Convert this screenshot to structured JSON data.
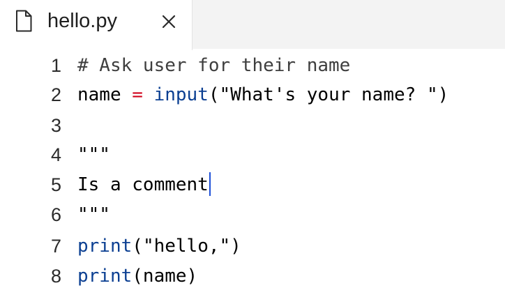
{
  "tab": {
    "title": "hello.py",
    "icon": "file-icon",
    "close_icon": "close-icon"
  },
  "editor": {
    "lines": [
      {
        "number": "1",
        "tokens": [
          {
            "type": "comment",
            "text": "# Ask user for their name"
          }
        ]
      },
      {
        "number": "2",
        "tokens": [
          {
            "type": "plain",
            "text": "name "
          },
          {
            "type": "op",
            "text": "="
          },
          {
            "type": "plain",
            "text": " "
          },
          {
            "type": "builtin",
            "text": "input"
          },
          {
            "type": "plain",
            "text": "("
          },
          {
            "type": "str",
            "text": "\"What's your name? \""
          },
          {
            "type": "plain",
            "text": ")"
          }
        ]
      },
      {
        "number": "3",
        "tokens": []
      },
      {
        "number": "4",
        "tokens": [
          {
            "type": "str",
            "text": "\"\"\""
          }
        ]
      },
      {
        "number": "5",
        "tokens": [
          {
            "type": "str",
            "text": "Is a comment"
          }
        ],
        "cursor": true
      },
      {
        "number": "6",
        "tokens": [
          {
            "type": "str",
            "text": "\"\"\""
          }
        ]
      },
      {
        "number": "7",
        "tokens": [
          {
            "type": "builtin",
            "text": "print"
          },
          {
            "type": "plain",
            "text": "("
          },
          {
            "type": "str",
            "text": "\"hello,\""
          },
          {
            "type": "plain",
            "text": ")"
          }
        ]
      },
      {
        "number": "8",
        "tokens": [
          {
            "type": "builtin",
            "text": "print"
          },
          {
            "type": "plain",
            "text": "(name)"
          }
        ]
      }
    ]
  },
  "colors": {
    "operator": "#d0021b",
    "builtin": "#0b3f92",
    "cursor": "#1c4fd8",
    "tabbar_bg": "#f3f3f3"
  }
}
